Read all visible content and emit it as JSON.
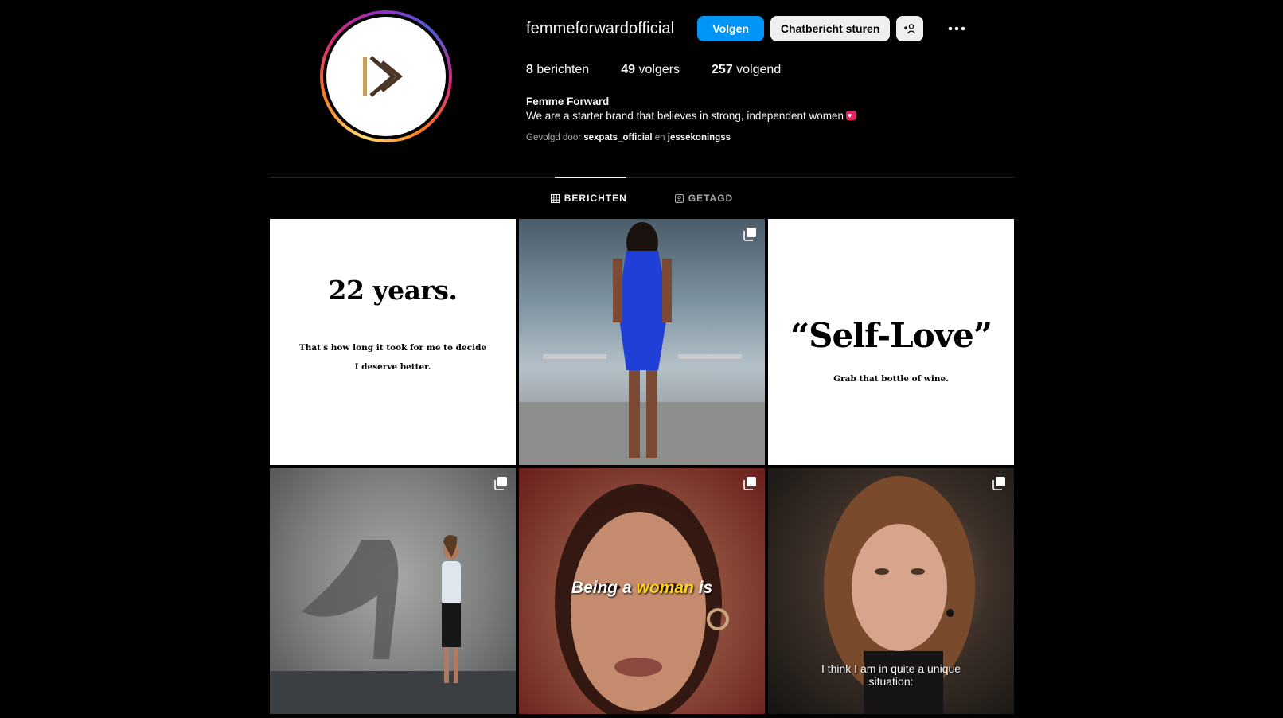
{
  "profile": {
    "username": "femmeforwardofficial",
    "avatar_icon": "play-chevron-logo-icon",
    "buttons": {
      "follow": "Volgen",
      "message": "Chatbericht sturen",
      "add_user_icon": "add-user-icon",
      "more_icon": "more-dots-icon"
    },
    "stats": [
      {
        "count": "8",
        "label": "berichten"
      },
      {
        "count": "49",
        "label": "volgers"
      },
      {
        "count": "257",
        "label": "volgend"
      }
    ],
    "bio": {
      "name": "Femme Forward",
      "text": "We are a starter brand that believes in strong, independent women",
      "emoji_icon": "heart-emoji-icon"
    },
    "followed_by": {
      "prefix": "Gevolgd door",
      "user1": "sexpats_official",
      "joiner": "en",
      "user2": "jessekoningss"
    }
  },
  "tabs": [
    {
      "label": "BERICHTEN",
      "icon": "grid-icon",
      "active": true
    },
    {
      "label": "GETAGD",
      "icon": "tagged-icon",
      "active": false
    }
  ],
  "posts": [
    {
      "kind": "text",
      "title": "22 years.",
      "line1": "That's how long it took for me to decide",
      "line2": "I deserve better."
    },
    {
      "kind": "photo",
      "subject": "woman in blue dress",
      "multi": true
    },
    {
      "kind": "text",
      "title": "“Self-Love”",
      "line1": "Grab that bottle of wine."
    },
    {
      "kind": "photo",
      "subject": "woman with superhero shadow",
      "multi": true
    },
    {
      "kind": "video",
      "caption_pre": "Being a",
      "caption_hl": "woman",
      "caption_post": "is",
      "multi": true
    },
    {
      "kind": "video",
      "caption_line1": "I think I am in quite a unique",
      "caption_line2": "situation:",
      "multi": true
    }
  ],
  "colors": {
    "accent": "#0095f6",
    "background": "#000000",
    "highlight_caption": "#ffd21a"
  }
}
